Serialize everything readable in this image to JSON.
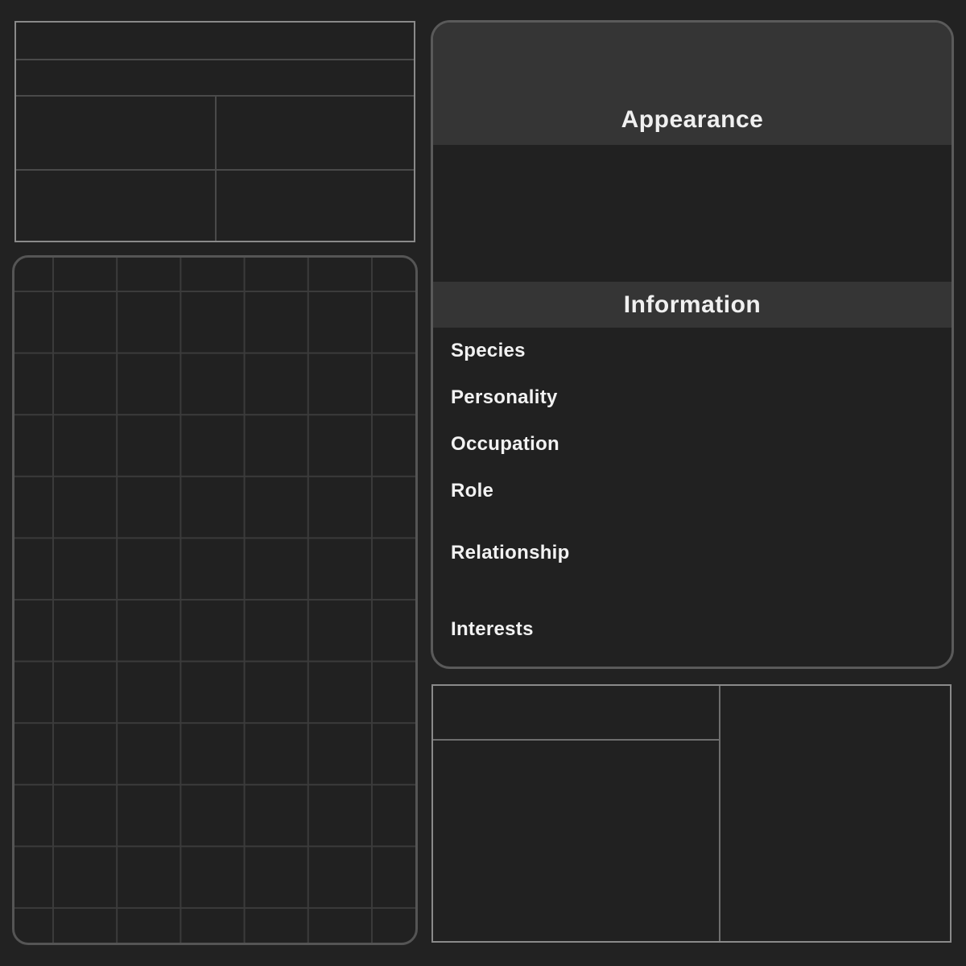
{
  "profile": {
    "appearance_title": "Appearance",
    "information_title": "Information",
    "fields": {
      "species": "Species",
      "personality": "Personality",
      "occupation": "Occupation",
      "role": "Role",
      "relationship": "Relationship",
      "interests": "Interests"
    }
  },
  "colors": {
    "background": "#222222",
    "header_band": "#353535",
    "text": "#f0f0f0",
    "table_border": "#8a8a8a",
    "grid_line": "#3b3b3b"
  }
}
